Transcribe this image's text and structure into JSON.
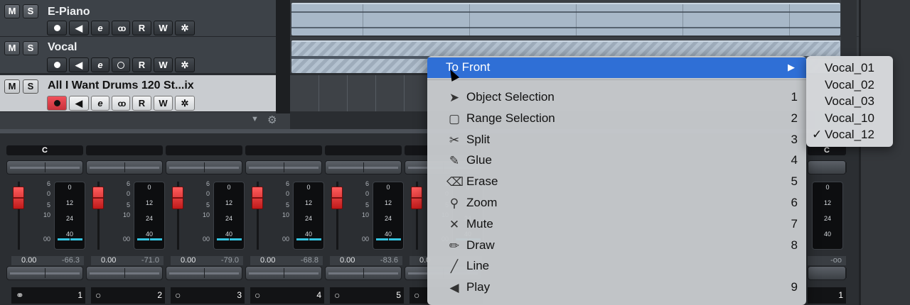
{
  "tracks": [
    {
      "name": "E-Piano",
      "mute": "M",
      "solo": "S",
      "read": "R",
      "write": "W"
    },
    {
      "name": "Vocal",
      "mute": "M",
      "solo": "S",
      "read": "R",
      "write": "W"
    },
    {
      "name": "All I Want Drums 120 St...ix",
      "mute": "M",
      "solo": "S",
      "read": "R",
      "write": "W",
      "selected": true,
      "record_enabled": true
    }
  ],
  "mixer": {
    "first_channel_label": "C",
    "right_channel_label": "C",
    "fader_scale": [
      "6",
      "0",
      "5",
      "10",
      "00"
    ],
    "meter_scale": [
      "0",
      "12",
      "24",
      "40"
    ],
    "channels": [
      {
        "volume": "0.00",
        "peak": "-66.3",
        "number": "1"
      },
      {
        "volume": "0.00",
        "peak": "-71.0",
        "number": "2"
      },
      {
        "volume": "0.00",
        "peak": "-79.0",
        "number": "3"
      },
      {
        "volume": "0.00",
        "peak": "-68.8",
        "number": "4"
      },
      {
        "volume": "0.00",
        "peak": "-83.6",
        "number": "5"
      },
      {
        "volume": "0.0",
        "peak": "",
        "number": ""
      }
    ],
    "right_channel": {
      "peak": "-oo",
      "number": "1"
    }
  },
  "context_menu": {
    "items": [
      {
        "label": "To Front",
        "key": "",
        "icon": "submenu-arrow",
        "highlighted": true
      },
      {
        "label": "Object Selection",
        "key": "1",
        "icon": "arrow-pointer-icon"
      },
      {
        "label": "Range Selection",
        "key": "2",
        "icon": "range-selection-icon"
      },
      {
        "label": "Split",
        "key": "3",
        "icon": "scissors-icon"
      },
      {
        "label": "Glue",
        "key": "4",
        "icon": "glue-icon"
      },
      {
        "label": "Erase",
        "key": "5",
        "icon": "eraser-icon"
      },
      {
        "label": "Zoom",
        "key": "6",
        "icon": "magnifier-icon"
      },
      {
        "label": "Mute",
        "key": "7",
        "icon": "x-icon"
      },
      {
        "label": "Draw",
        "key": "8",
        "icon": "pencil-icon"
      },
      {
        "label": "Line",
        "key": "",
        "icon": "line-icon"
      },
      {
        "label": "Play",
        "key": "9",
        "icon": "speaker-icon"
      }
    ],
    "submenu_arrow": "▶"
  },
  "submenu": {
    "items": [
      {
        "label": "Vocal_01",
        "checked": false
      },
      {
        "label": "Vocal_02",
        "checked": false
      },
      {
        "label": "Vocal_03",
        "checked": false
      },
      {
        "label": "Vocal_10",
        "checked": false
      },
      {
        "label": "Vocal_12",
        "checked": true
      }
    ],
    "check_mark": "✓"
  }
}
